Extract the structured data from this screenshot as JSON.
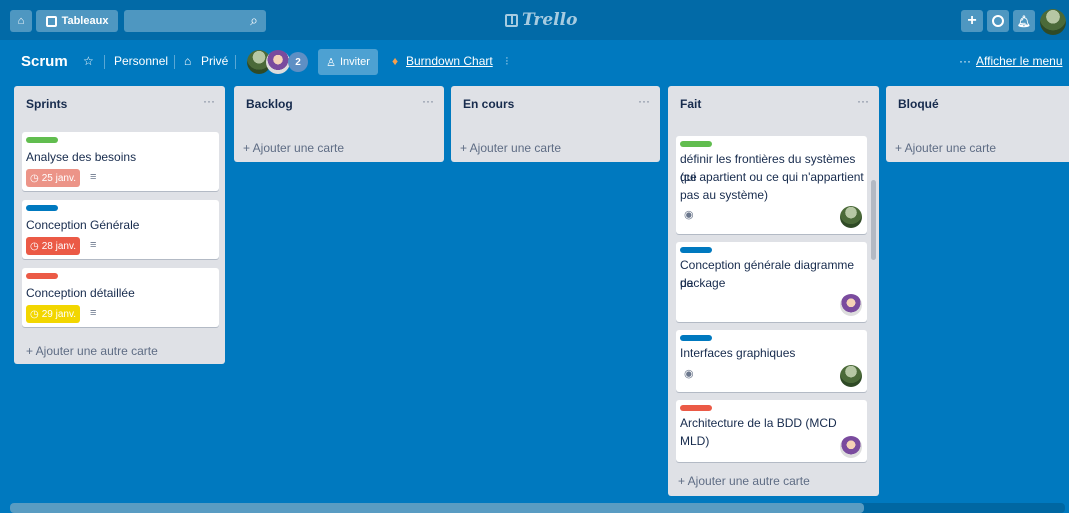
{
  "header": {
    "boards_label": "Tableaux",
    "logo_text": "Trello",
    "icons": [
      "home-icon",
      "boards-icon",
      "search-icon",
      "plus-icon",
      "info-icon",
      "bell-icon"
    ]
  },
  "board": {
    "title": "Scrum",
    "visibility_team": "Personnel",
    "visibility": "Privé",
    "member_count": "2",
    "invite_label": "Inviter",
    "powerup_label": "Burndown Chart",
    "show_menu_label": "Afficher le menu",
    "show_menu_prefix": "···"
  },
  "colors": {
    "background": "#0079bf",
    "header": "#026aa7",
    "label_green": "#61bd4f",
    "label_blue": "#0079bf",
    "label_red": "#eb5a46",
    "due_soon": "#ec9488",
    "due_overdue": "#eb5a46",
    "due_yellow": "#f2d600"
  },
  "lists": [
    {
      "title": "Sprints",
      "menu": "···",
      "add_label": "+ Ajouter une autre carte",
      "cards": [
        {
          "label_color": "#61bd4f",
          "text": "Analyse des besoins",
          "due": "25 janv.",
          "due_color": "#ec9488"
        },
        {
          "label_color": "#0079bf",
          "text": "Conception Générale",
          "due": "28 janv.",
          "due_color": "#eb5a46"
        },
        {
          "label_color": "#eb5a46",
          "text": "Conception détaillée",
          "due": "29 janv.",
          "due_color": "#f2d600"
        }
      ]
    },
    {
      "title": "Backlog",
      "menu": "···",
      "add_label": "+ Ajouter une carte"
    },
    {
      "title": "En cours",
      "menu": "···",
      "add_label": "+ Ajouter une carte"
    },
    {
      "title": "Fait",
      "menu": "···",
      "add_label": "+ Ajouter une autre carte",
      "cards": [
        {
          "label_color": "#61bd4f",
          "lines": [
            "définir les frontières du systèmes (ce",
            "qui apartient ou ce qui n'appartient",
            "pas au système)"
          ]
        },
        {
          "label_color": "#0079bf",
          "lines": [
            "Conception générale diagramme de",
            "package"
          ]
        },
        {
          "label_color": "#0079bf",
          "lines": [
            "Interfaces graphiques"
          ]
        },
        {
          "label_color": "#eb5a46",
          "lines": [
            "Architecture de la BDD (MCD MLD)"
          ]
        }
      ]
    },
    {
      "title": "Bloqué",
      "add_label": "+ Ajouter une carte"
    }
  ]
}
